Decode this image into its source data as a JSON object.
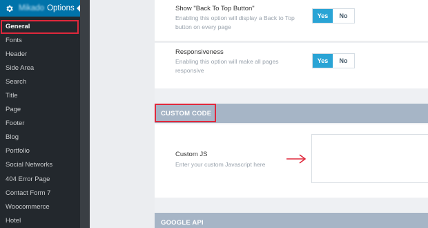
{
  "sidebar": {
    "header": {
      "brand": "Mikado",
      "label": "Options"
    },
    "items": [
      {
        "label": "General",
        "active": true
      },
      {
        "label": "Fonts"
      },
      {
        "label": "Header"
      },
      {
        "label": "Side Area"
      },
      {
        "label": "Search"
      },
      {
        "label": "Title"
      },
      {
        "label": "Page"
      },
      {
        "label": "Footer"
      },
      {
        "label": "Blog"
      },
      {
        "label": "Portfolio"
      },
      {
        "label": "Social Networks"
      },
      {
        "label": "404 Error Page"
      },
      {
        "label": "Contact Form 7"
      },
      {
        "label": "Woocommerce"
      },
      {
        "label": "Hotel"
      }
    ]
  },
  "options": {
    "back_to_top": {
      "title": "Show \"Back To Top Button\"",
      "description": "Enabling this option will display a Back to Top button on every page",
      "yes": "Yes",
      "no": "No"
    },
    "responsiveness": {
      "title": "Responsiveness",
      "description": "Enabling this option will make all pages responsive",
      "yes": "Yes",
      "no": "No"
    }
  },
  "sections": {
    "custom_code": {
      "title": "CUSTOM CODE",
      "custom_js": {
        "title": "Custom JS",
        "description": "Enter your custom Javascript here",
        "value": ""
      }
    },
    "google_api": {
      "title": "GOOGLE API"
    }
  },
  "colors": {
    "admin_bar": "#23282d",
    "accent_blue": "#0073aa",
    "toggle_active": "#2aa4d5",
    "section_bar": "#a6b5c6",
    "highlight": "#e0283c"
  },
  "icons": {
    "menu": "gear-icon",
    "pointer": "arrow-right-icon"
  }
}
